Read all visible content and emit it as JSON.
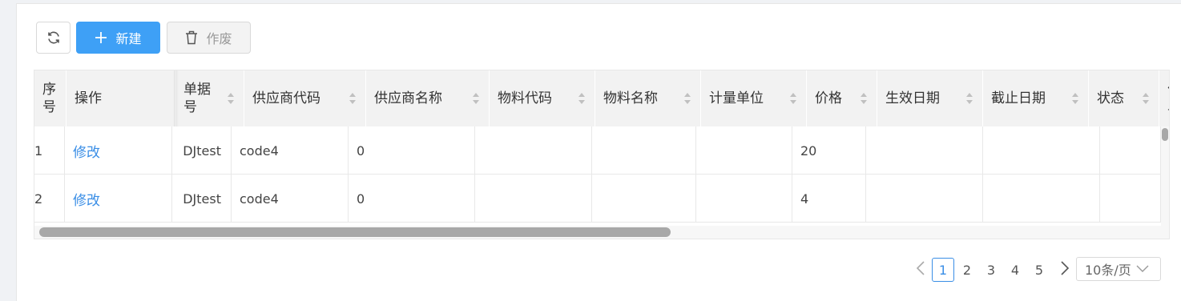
{
  "toolbar": {
    "refresh_icon": "refresh-icon",
    "new_label": "新建",
    "new_icon": "plus-icon",
    "void_label": "作废",
    "void_icon": "trash-icon"
  },
  "table": {
    "columns": [
      {
        "key": "seq",
        "label": "序\n号",
        "sortable": false
      },
      {
        "key": "action",
        "label": "操作",
        "sortable": false
      },
      {
        "key": "doc_no",
        "label": "单据\n号",
        "sortable": true
      },
      {
        "key": "supplier_code",
        "label": "供应商代码",
        "sortable": true
      },
      {
        "key": "supplier_name",
        "label": "供应商名称",
        "sortable": true
      },
      {
        "key": "material_code",
        "label": "物料代码",
        "sortable": true
      },
      {
        "key": "material_name",
        "label": "物料名称",
        "sortable": true
      },
      {
        "key": "unit",
        "label": "计量单位",
        "sortable": true
      },
      {
        "key": "price",
        "label": "价格",
        "sortable": true
      },
      {
        "key": "effective_date",
        "label": "生效日期",
        "sortable": true
      },
      {
        "key": "expiry_date",
        "label": "截止日期",
        "sortable": true
      },
      {
        "key": "status",
        "label": "状态",
        "sortable": true
      },
      {
        "key": "extra",
        "label": "价\n单",
        "sortable": false
      }
    ],
    "rows": [
      {
        "seq": "1",
        "action": "修改",
        "doc_no": "DJtest",
        "supplier_code": "code4",
        "supplier_name": "0",
        "material_code": "",
        "material_name": "",
        "unit": "",
        "price": "20",
        "effective_date": "",
        "expiry_date": "",
        "status": ""
      },
      {
        "seq": "2",
        "action": "修改",
        "doc_no": "DJtest",
        "supplier_code": "code4",
        "supplier_name": "0",
        "material_code": "",
        "material_name": "",
        "unit": "",
        "price": "4",
        "effective_date": "",
        "expiry_date": "",
        "status": ""
      }
    ]
  },
  "pagination": {
    "prev_icon": "chevron-left-icon",
    "next_icon": "chevron-right-icon",
    "pages": [
      "1",
      "2",
      "3",
      "4",
      "5"
    ],
    "current": "1",
    "page_size": "10条/页"
  }
}
